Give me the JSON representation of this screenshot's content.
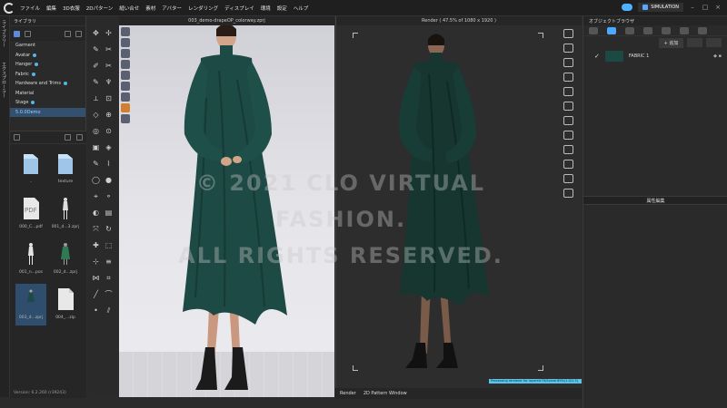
{
  "menu": [
    "ファイル",
    "編集",
    "3D衣服",
    "2Dパターン",
    "縫い合せ",
    "素材",
    "アバター",
    "レンダリング",
    "ディスプレイ",
    "環境",
    "設定",
    "ヘルプ"
  ],
  "top_right": {
    "simulation": "SIMULATION"
  },
  "left_tabs": [
    "ライブラリー",
    "エクスプローラー"
  ],
  "library": {
    "title": "ライブラリ",
    "tree": [
      "Garment",
      "Avatar",
      "Hanger",
      "Fabric",
      "Hardware and Trims",
      "Material",
      "Stage",
      "5.0.0Demo"
    ],
    "files": [
      {
        "label": ".."
      },
      {
        "label": "texture"
      },
      {
        "label": "000_C...pdf"
      },
      {
        "label": "001_d...3.zprj"
      },
      {
        "label": "001_n...pos"
      },
      {
        "label": "002_d...zprj"
      },
      {
        "label": "003_d...zprj"
      },
      {
        "label": "004_...zip"
      }
    ],
    "version": "Version: 6.2.260 (r39243)"
  },
  "viewport": {
    "title": "003_demo-drapeOP_colorway.zprj"
  },
  "render": {
    "title": "Render ( 47.5% of 1080 x 1920 )",
    "status": "Processing renderer for layered Fit/Scene 89%(1.0/1.3)",
    "tabs": [
      "Render",
      "2D Pattern Window"
    ]
  },
  "object_browser": {
    "title": "オブジェクトブラウザ",
    "add_label": "+ 追加",
    "fabric_name": "FABRIC 1",
    "property_editor": "属性編集"
  },
  "watermark": [
    "© 2021 CLO VIRTUAL FASHION.",
    "ALL RIGHTS RESERVED."
  ],
  "colors": {
    "dress": "#1d4a44",
    "accent": "#4ca7ff"
  }
}
